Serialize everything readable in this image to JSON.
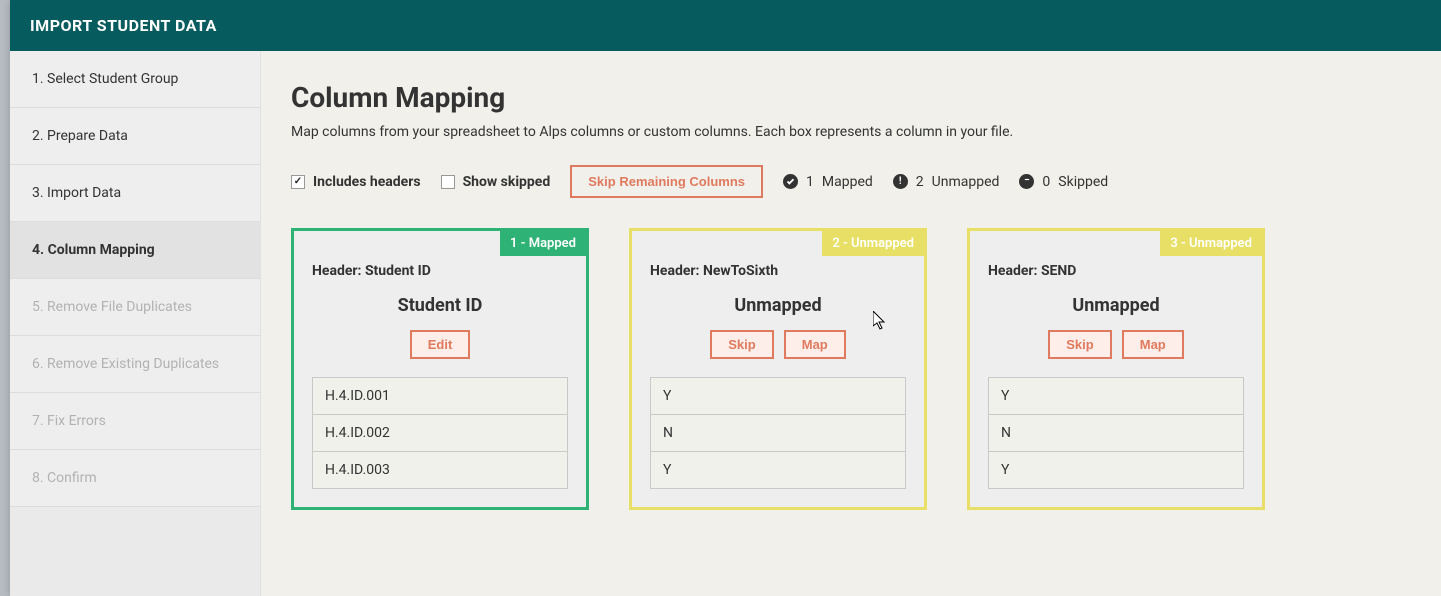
{
  "header": {
    "title": "Import Student Data"
  },
  "sidebar": {
    "items": [
      {
        "label": "1. Select Student Group",
        "state": "normal"
      },
      {
        "label": "2. Prepare Data",
        "state": "normal"
      },
      {
        "label": "3. Import Data",
        "state": "normal"
      },
      {
        "label": "4. Column Mapping",
        "state": "active"
      },
      {
        "label": "5. Remove File Duplicates",
        "state": "disabled"
      },
      {
        "label": "6. Remove Existing Duplicates",
        "state": "disabled"
      },
      {
        "label": "7. Fix Errors",
        "state": "disabled"
      },
      {
        "label": "8. Confirm",
        "state": "disabled"
      }
    ]
  },
  "main": {
    "title": "Column Mapping",
    "description": "Map columns from your spreadsheet to Alps columns or custom columns. Each box represents a column in your file."
  },
  "toolbar": {
    "includes_headers_label": "Includes headers",
    "includes_headers_checked": true,
    "show_skipped_label": "Show skipped",
    "show_skipped_checked": false,
    "skip_remaining_label": "Skip Remaining Columns",
    "mapped": {
      "count": 1,
      "label": "Mapped"
    },
    "unmapped": {
      "count": 2,
      "label": "Unmapped"
    },
    "skipped": {
      "count": 0,
      "label": "Skipped"
    }
  },
  "buttons": {
    "edit": "Edit",
    "skip": "Skip",
    "map": "Map"
  },
  "cards": [
    {
      "badge": "1 - Mapped",
      "status": "mapped",
      "header_prefix": "Header:",
      "header_value": "Student ID",
      "title": "Student ID",
      "actions": [
        "edit"
      ],
      "rows": [
        "H.4.ID.001",
        "H.4.ID.002",
        "H.4.ID.003"
      ]
    },
    {
      "badge": "2 - Unmapped",
      "status": "unmapped",
      "header_prefix": "Header:",
      "header_value": "NewToSixth",
      "title": "Unmapped",
      "actions": [
        "skip",
        "map"
      ],
      "rows": [
        "Y",
        "N",
        "Y"
      ]
    },
    {
      "badge": "3 - Unmapped",
      "status": "unmapped",
      "header_prefix": "Header:",
      "header_value": "SEND",
      "title": "Unmapped",
      "actions": [
        "skip",
        "map"
      ],
      "rows": [
        "Y",
        "N",
        "Y"
      ]
    }
  ]
}
